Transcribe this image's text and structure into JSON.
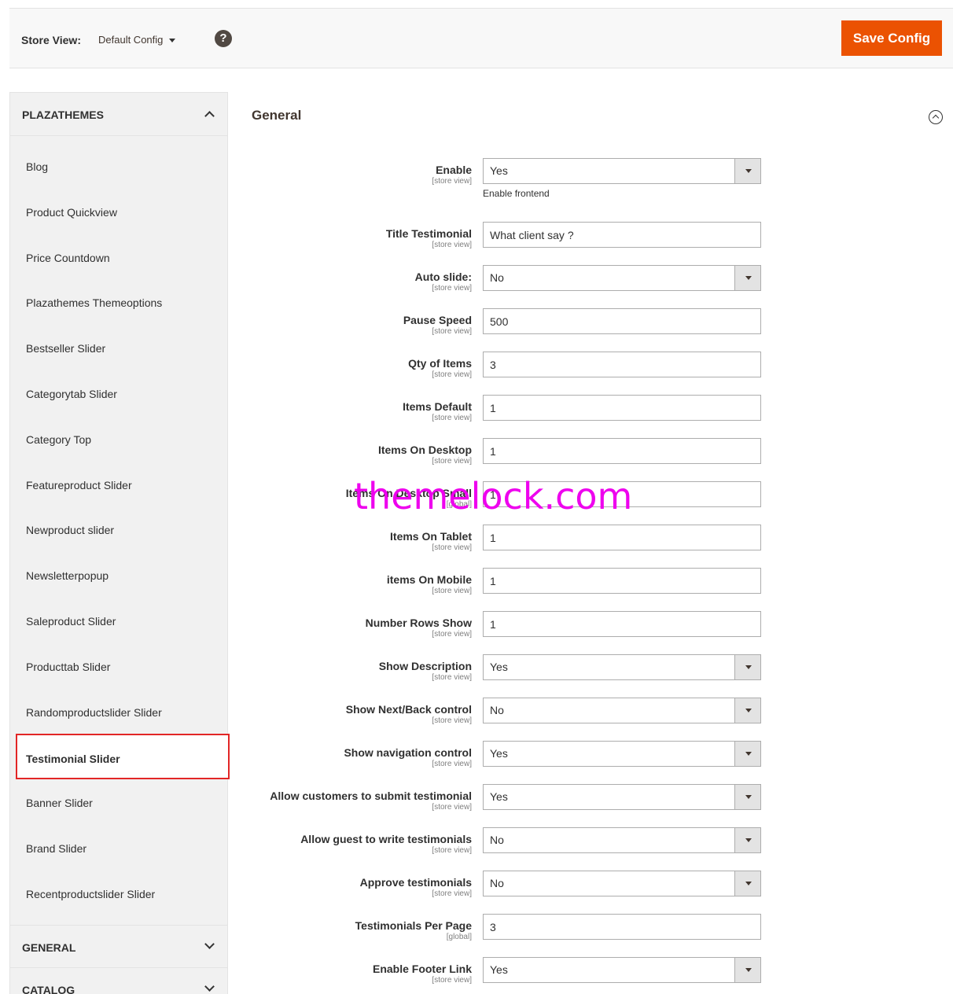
{
  "topbar": {
    "store_view_label": "Store View:",
    "store_view_value": "Default Config",
    "help": "?",
    "save_label": "Save Config"
  },
  "sidebar": {
    "section": "PLAZATHEMES",
    "items": [
      {
        "label": "Blog"
      },
      {
        "label": "Product Quickview"
      },
      {
        "label": "Price Countdown"
      },
      {
        "label": "Plazathemes Themeoptions"
      },
      {
        "label": "Bestseller Slider"
      },
      {
        "label": "Categorytab Slider"
      },
      {
        "label": "Category Top"
      },
      {
        "label": "Featureproduct Slider"
      },
      {
        "label": "Newproduct slider"
      },
      {
        "label": "Newsletterpopup"
      },
      {
        "label": "Saleproduct Slider"
      },
      {
        "label": "Producttab Slider"
      },
      {
        "label": "Randomproductslider Slider"
      },
      {
        "label": "Testimonial Slider",
        "active": true
      },
      {
        "label": "Banner Slider"
      },
      {
        "label": "Brand Slider"
      },
      {
        "label": "Recentproductslider Slider"
      }
    ],
    "general": "GENERAL",
    "catalog": "CATALOG"
  },
  "main": {
    "title": "General",
    "enable_note": "Enable frontend",
    "fields": [
      {
        "label": "Enable",
        "scope": "[store view]",
        "type": "select",
        "value": "Yes"
      },
      {
        "label": "Title Testimonial",
        "scope": "[store view]",
        "type": "text",
        "value": "What client say ?"
      },
      {
        "label": "Auto slide:",
        "scope": "[store view]",
        "type": "select",
        "value": "No"
      },
      {
        "label": "Pause Speed",
        "scope": "[store view]",
        "type": "text",
        "value": "500"
      },
      {
        "label": "Qty of Items",
        "scope": "[store view]",
        "type": "text",
        "value": "3"
      },
      {
        "label": "Items Default",
        "scope": "[store view]",
        "type": "text",
        "value": "1"
      },
      {
        "label": "Items On Desktop",
        "scope": "[store view]",
        "type": "text",
        "value": "1"
      },
      {
        "label": "Items On Desktop Small",
        "scope": "[global]",
        "type": "text",
        "value": "1"
      },
      {
        "label": "Items On Tablet",
        "scope": "[store view]",
        "type": "text",
        "value": "1"
      },
      {
        "label": "items On Mobile",
        "scope": "[store view]",
        "type": "text",
        "value": "1"
      },
      {
        "label": "Number Rows Show",
        "scope": "[store view]",
        "type": "text",
        "value": "1"
      },
      {
        "label": "Show Description",
        "scope": "[store view]",
        "type": "select",
        "value": "Yes"
      },
      {
        "label": "Show Next/Back control",
        "scope": "[store view]",
        "type": "select",
        "value": "No"
      },
      {
        "label": "Show navigation control",
        "scope": "[store view]",
        "type": "select",
        "value": "Yes"
      },
      {
        "label": "Allow customers to submit testimonial",
        "scope": "[store view]",
        "type": "select",
        "value": "Yes"
      },
      {
        "label": "Allow guest to write testimonials",
        "scope": "[store view]",
        "type": "select",
        "value": "No"
      },
      {
        "label": "Approve testimonials",
        "scope": "[store view]",
        "type": "select",
        "value": "No"
      },
      {
        "label": "Testimonials Per Page",
        "scope": "[global]",
        "type": "text",
        "value": "3"
      },
      {
        "label": "Enable Footer Link",
        "scope": "[store view]",
        "type": "select",
        "value": "Yes"
      }
    ]
  },
  "watermark": "themelock.com",
  "colors": {
    "accent": "#eb5202",
    "active_border": "#e22626",
    "watermark": "#ee00ee"
  }
}
